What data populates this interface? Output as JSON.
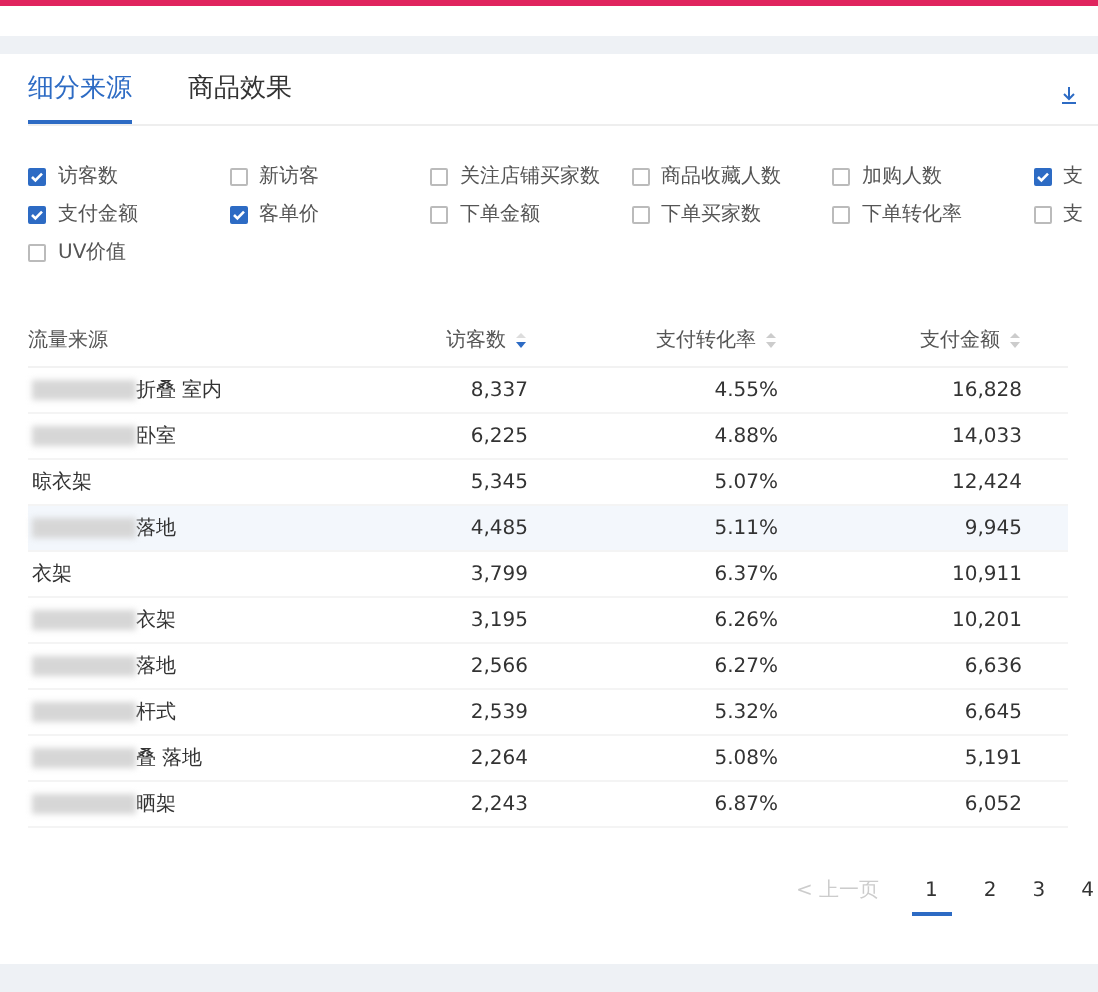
{
  "tabs": [
    {
      "label": "细分来源",
      "selected": true
    },
    {
      "label": "商品效果",
      "selected": false
    }
  ],
  "metrics": [
    [
      {
        "label": "访客数",
        "checked": true
      },
      {
        "label": "新访客",
        "checked": false
      },
      {
        "label": "关注店铺买家数",
        "checked": false
      },
      {
        "label": "商品收藏人数",
        "checked": false
      },
      {
        "label": "加购人数",
        "checked": false
      },
      {
        "label": "支",
        "checked": true
      }
    ],
    [
      {
        "label": "支付金额",
        "checked": true
      },
      {
        "label": "客单价",
        "checked": true
      },
      {
        "label": "下单金额",
        "checked": false
      },
      {
        "label": "下单买家数",
        "checked": false
      },
      {
        "label": "下单转化率",
        "checked": false
      },
      {
        "label": "支",
        "checked": false
      }
    ],
    [
      {
        "label": "UV价值",
        "checked": false
      }
    ]
  ],
  "table": {
    "columns": [
      {
        "label": "流量来源"
      },
      {
        "label": "访客数",
        "sort_active": true
      },
      {
        "label": "支付转化率",
        "sort_active": false
      },
      {
        "label": "支付金额",
        "sort_active": false
      }
    ],
    "rows": [
      {
        "source": "折叠 室内",
        "blurred": true,
        "selected": false,
        "visitors": "8,337",
        "rate": "4.55%",
        "amount": "16,828"
      },
      {
        "source": "卧室",
        "blurred": true,
        "selected": false,
        "visitors": "6,225",
        "rate": "4.88%",
        "amount": "14,033"
      },
      {
        "source": "晾衣架",
        "blurred": false,
        "selected": false,
        "visitors": "5,345",
        "rate": "5.07%",
        "amount": "12,424"
      },
      {
        "source": "落地",
        "blurred": true,
        "selected": true,
        "visitors": "4,485",
        "rate": "5.11%",
        "amount": "9,945"
      },
      {
        "source": "衣架",
        "blurred": false,
        "selected": false,
        "visitors": "3,799",
        "rate": "6.37%",
        "amount": "10,911"
      },
      {
        "source": "衣架",
        "blurred": true,
        "selected": false,
        "visitors": "3,195",
        "rate": "6.26%",
        "amount": "10,201"
      },
      {
        "source": "落地",
        "blurred": true,
        "selected": false,
        "visitors": "2,566",
        "rate": "6.27%",
        "amount": "6,636"
      },
      {
        "source": "杆式",
        "blurred": true,
        "selected": false,
        "visitors": "2,539",
        "rate": "5.32%",
        "amount": "6,645"
      },
      {
        "source": "叠 落地",
        "blurred": true,
        "selected": false,
        "visitors": "2,264",
        "rate": "5.08%",
        "amount": "5,191"
      },
      {
        "source": "晒架",
        "blurred": true,
        "selected": false,
        "visitors": "2,243",
        "rate": "6.87%",
        "amount": "6,052"
      }
    ]
  },
  "pagination": {
    "prev": "< 上一页",
    "pages": [
      {
        "label": "1",
        "selected": true
      },
      {
        "label": "2",
        "selected": false
      },
      {
        "label": "3",
        "selected": false
      },
      {
        "label": "4",
        "selected": false
      }
    ]
  }
}
